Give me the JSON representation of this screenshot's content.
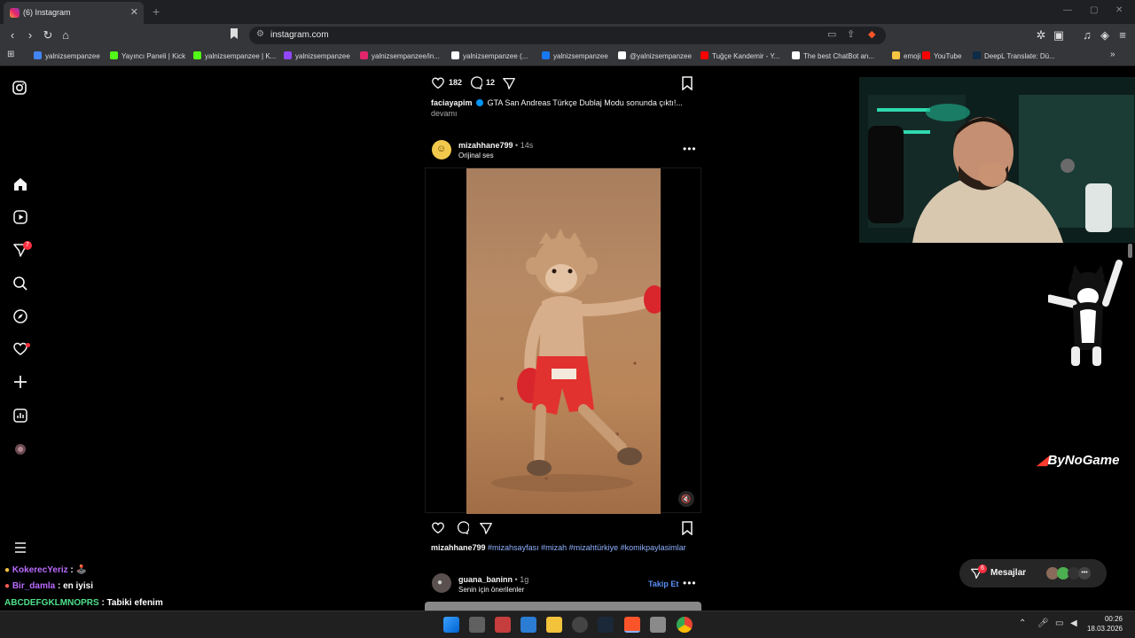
{
  "browser": {
    "tab_title": "(6) Instagram",
    "url": "instagram.com",
    "bookmarks": [
      "yalnizsempanzee",
      "Yayıncı Paneli | Kick",
      "yalnizsempanzee | K...",
      "yalnizsempanzee",
      "yalnizsempanzee/in...",
      "yalnizsempanzee (...",
      "yalnizsempanzee",
      "@yalnizsempanzee",
      "Tuğçe Kandemir - Y...",
      "The best ChatBot an...",
      "emoji",
      "YouTube",
      "DeepL Translate: Dü..."
    ],
    "bookmark_colors": [
      "#4285f4",
      "#53fc18",
      "#53fc18",
      "#9146ff",
      "#e3256b",
      "#ffffff",
      "#1877f2",
      "#ffffff",
      "#ff0000",
      "#ffffff",
      "#f5c542",
      "#ff0000",
      "#0f2b46"
    ]
  },
  "sidebar": {
    "notifications_badge": "7"
  },
  "prev_post": {
    "likes": "182",
    "comments": "12",
    "username": "faciayapim",
    "caption": "GTA San Andreas Türkçe Dublaj Modu sonunda çıktı!...",
    "more": "devamı"
  },
  "post": {
    "username": "mizahhane799",
    "separator": "•",
    "time": "14s",
    "audio": "Orijinal ses",
    "caption_user": "mizahhane799",
    "hashtags": "#mizahsayfası #mizah #mizahtürkiye #komikpaylasimlar"
  },
  "next_post": {
    "username": "guana_baninn",
    "time": "1g",
    "subtitle": "Senin için önerilenler",
    "follow": "Takip Et"
  },
  "stream": {
    "logo_text": "ByNoGame"
  },
  "messages": {
    "label": "Mesajlar",
    "badge": "6"
  },
  "chat": [
    {
      "user": "KokerecYeriz",
      "sep": " :",
      "text": " 🕹️",
      "color": "#b96bff"
    },
    {
      "user": "Bir_damla",
      "sep": " :",
      "text": " en iyisi",
      "color": "#b96bff"
    },
    {
      "user": "ABCDEFGKLMNOPRS",
      "sep": " :",
      "text": " Tabiki efenim",
      "color": "#4ee08a"
    }
  ],
  "taskbar": {
    "time": "00:26",
    "date": "18.03.2026"
  }
}
